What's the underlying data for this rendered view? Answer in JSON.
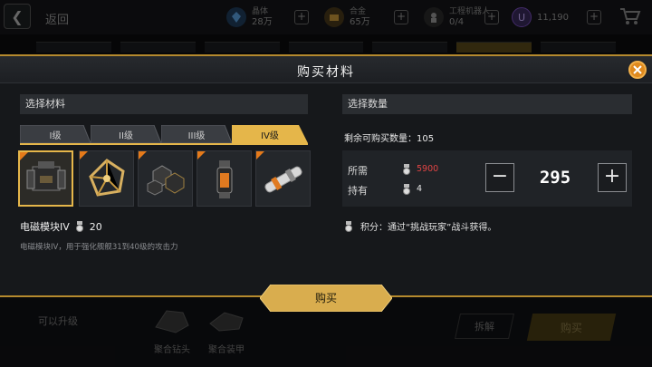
{
  "topbar": {
    "back_label": "返回",
    "resources": [
      {
        "name": "晶体",
        "value": "28万",
        "icon": "crystal-icon",
        "color": "#3f7fbf"
      },
      {
        "name": "合金",
        "value": "65万",
        "icon": "alloy-icon",
        "color": "#b07d2a"
      },
      {
        "name": "工程机器人",
        "value": "0/4",
        "icon": "robot-icon",
        "color": "#8a8a8a"
      },
      {
        "name": "",
        "value": "11,190",
        "icon": "u-currency-icon",
        "color": "#7a4fc0"
      }
    ]
  },
  "modal": {
    "title": "购买材料",
    "left": {
      "section_title": "选择材料",
      "tabs": [
        "I级",
        "II级",
        "III级",
        "IV级"
      ],
      "active_tab": 3,
      "items": [
        {
          "name": "electromagnetic-module",
          "selected": true
        },
        {
          "name": "gold-lattice",
          "selected": false
        },
        {
          "name": "hex-plates",
          "selected": false
        },
        {
          "name": "orange-capsule",
          "selected": false
        },
        {
          "name": "cylinder-part",
          "selected": false
        }
      ],
      "selected_name": "电磁模块IV",
      "selected_count": "20",
      "description": "电磁模块IV，用于强化舰舰31到40级的攻击力"
    },
    "right": {
      "section_title": "选择数量",
      "remaining_label": "剩余可购买数量：",
      "remaining_value": "105",
      "required_label": "所需",
      "required_value": "5900",
      "owned_label": "持有",
      "owned_value": "4",
      "quantity": "295",
      "minus": "−",
      "plus": "+",
      "hint": "积分：通过“挑战玩家”战斗获得。"
    },
    "buy_label": "购买"
  },
  "background": {
    "upgrade_label": "可以升级",
    "items": [
      "聚合钻头",
      "聚合装甲"
    ],
    "disassemble_label": "拆解",
    "buy_label": "购买"
  },
  "colors": {
    "accent_gold": "#e5b64a",
    "required_red": "#e04444",
    "close_orange": "#e08a1e"
  }
}
